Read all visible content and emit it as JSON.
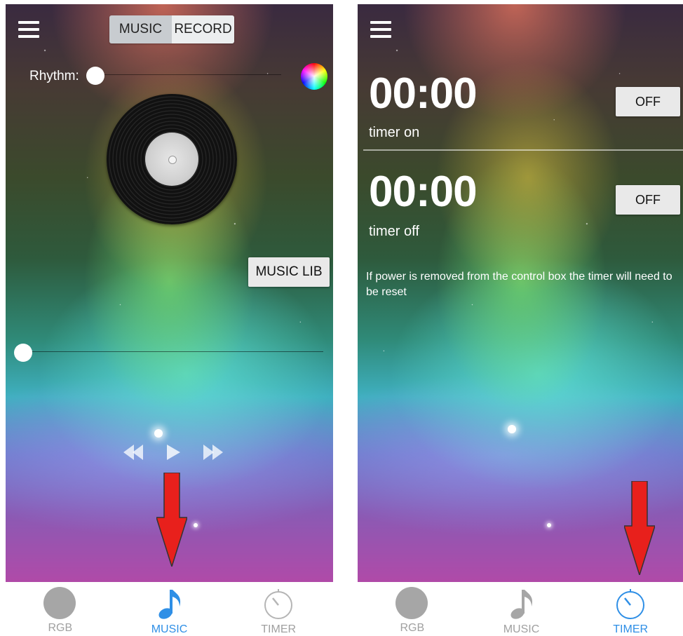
{
  "left_screen": {
    "header": {
      "menu_icon": "hamburger-menu-icon",
      "segments": [
        {
          "label": "MUSIC",
          "selected": true
        },
        {
          "label": "RECORD",
          "selected": false
        }
      ]
    },
    "rhythm": {
      "label": "Rhythm:",
      "level": 0
    },
    "color_picker_icon": "color-wheel-icon",
    "music_lib_label": "MUSIC LIB",
    "playback": {
      "progress": 0,
      "controls": [
        "rewind-icon",
        "play-icon",
        "fast-forward-icon"
      ]
    }
  },
  "right_screen": {
    "header": {
      "menu_icon": "hamburger-menu-icon"
    },
    "timer_on": {
      "time": "00:00",
      "caption": "timer on",
      "button_label": "OFF"
    },
    "timer_off": {
      "time": "00:00",
      "caption": "timer off",
      "button_label": "OFF"
    },
    "note": "If power is removed from the control box the timer will need to be reset"
  },
  "bottom_nav": {
    "items": [
      {
        "label": "RGB",
        "icon": "rgb-circle-icon"
      },
      {
        "label": "MUSIC",
        "icon": "music-note-icon"
      },
      {
        "label": "TIMER",
        "icon": "timer-icon"
      }
    ],
    "left_active": "MUSIC",
    "right_active": "TIMER",
    "active_color": "#2f8fe6",
    "inactive_color": "#a0a0a0"
  },
  "annotation_arrow_color": "#e8201c"
}
